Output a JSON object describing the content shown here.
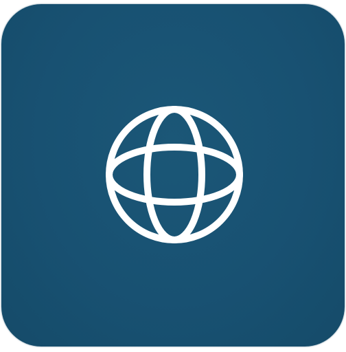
{
  "app_icon": {
    "icon": "globe-icon",
    "background_color": "#185172",
    "glyph_color": "#ffffff"
  }
}
